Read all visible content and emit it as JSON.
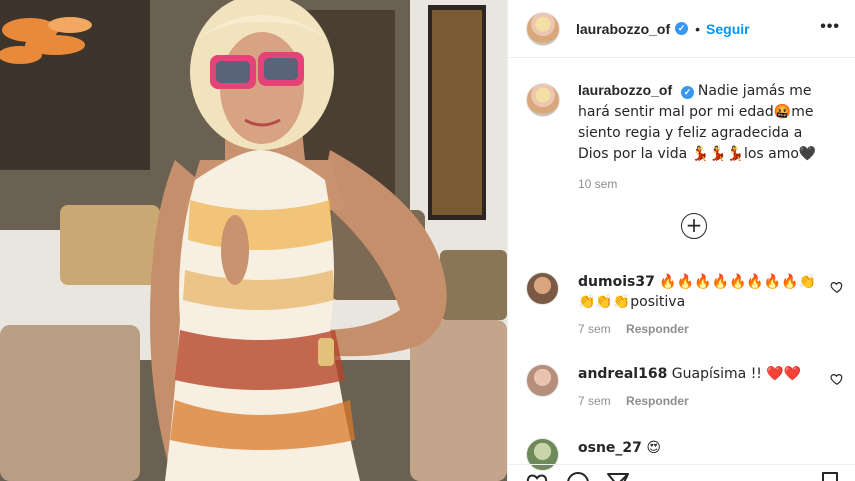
{
  "post": {
    "author": "laurabozzo_of",
    "follow_label": "Seguir",
    "separator": "•",
    "more_label": "•••",
    "caption_text": "Nadie jamás me hará sentir mal por mi edad🤬me siento regia y feliz agradecida a Dios por la vida 💃💃💃los amo🖤",
    "caption_time": "10 sem",
    "load_more_label": "+"
  },
  "comments": [
    {
      "user": "dumois37",
      "text": "🔥🔥🔥🔥🔥🔥🔥🔥👏👏👏👏positiva",
      "time": "7 sem",
      "reply": "Responder",
      "avatar_color": "#7a5a44"
    },
    {
      "user": "andreal168",
      "text": "Guapísima !! ❤️❤️",
      "time": "7 sem",
      "reply": "Responder",
      "avatar_color": "#b58f7c"
    },
    {
      "user": "osne_27",
      "text": "😍",
      "avatar_color": "#6e8a5a"
    }
  ],
  "colors": {
    "accent": "#0095f6",
    "verified": "#3897f0",
    "secondary_text": "#8e8e8e"
  },
  "icons": [
    "verified-badge-icon",
    "more-options-icon",
    "load-more-icon",
    "heart-icon",
    "comment-icon",
    "share-icon",
    "save-icon"
  ]
}
